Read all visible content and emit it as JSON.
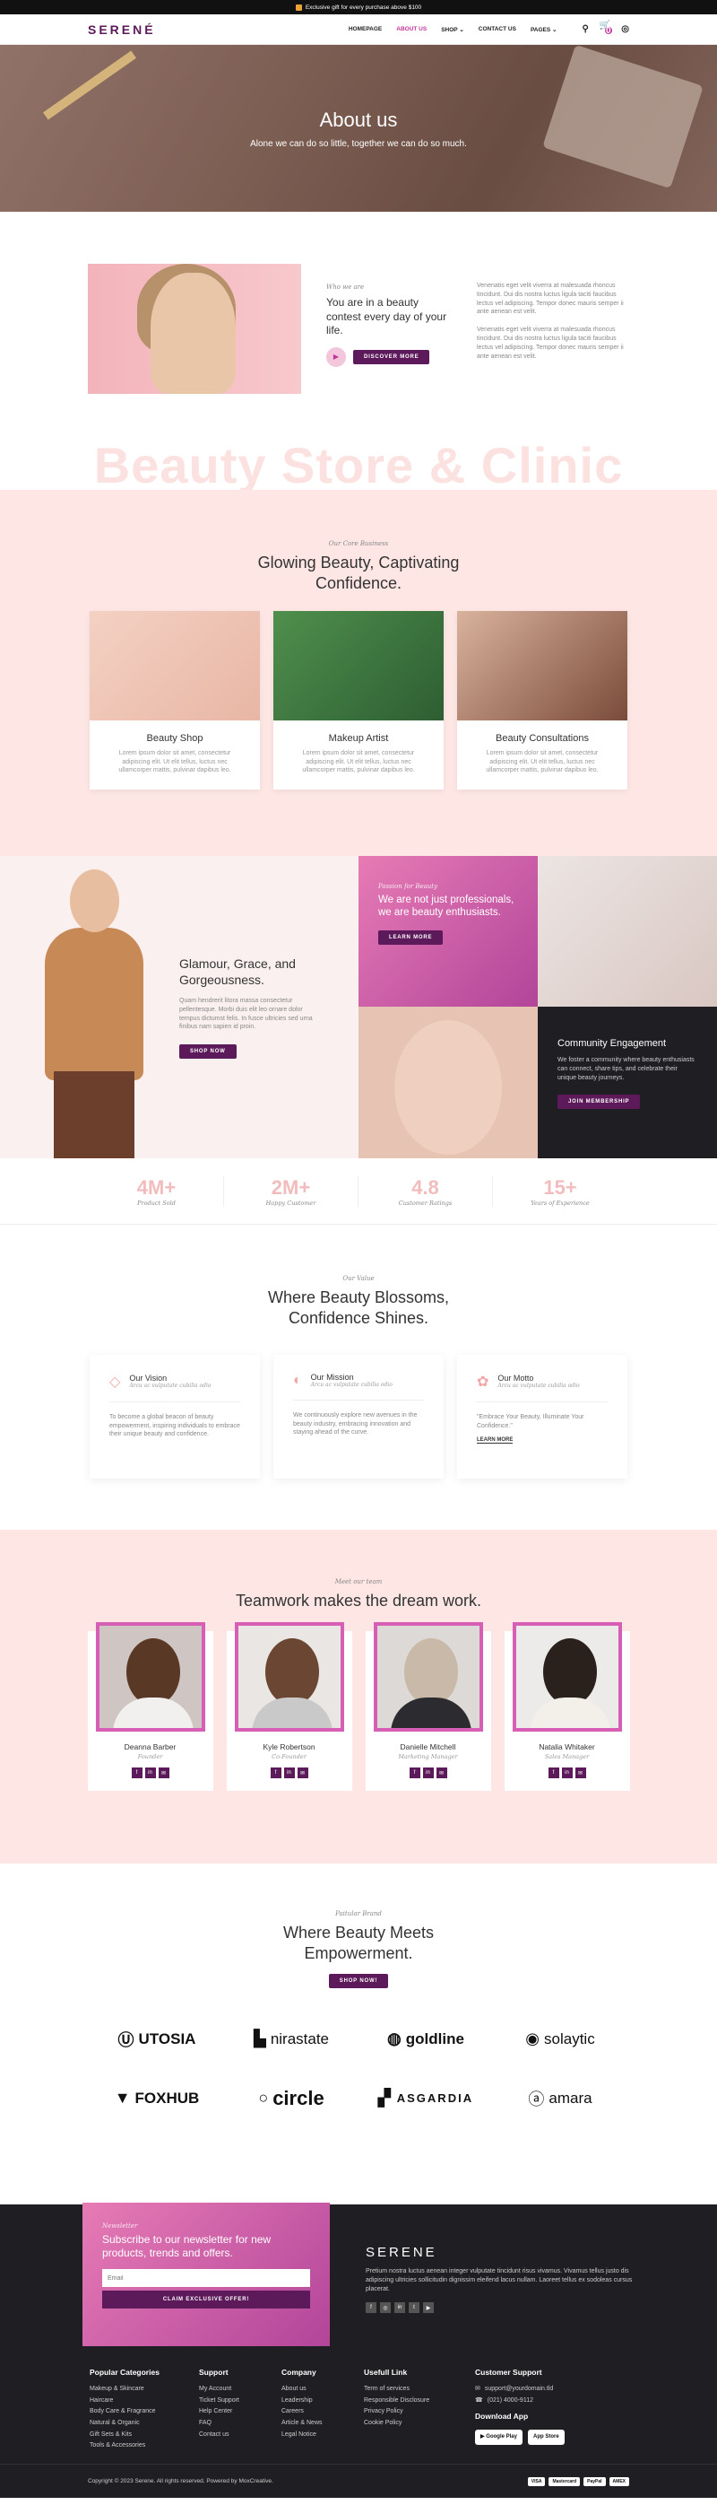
{
  "topbar": {
    "text": "Exclusive gift for every purchase above $100"
  },
  "header": {
    "logo": "SERENÉ",
    "nav": [
      "HOMEPAGE",
      "ABOUT US",
      "SHOP",
      "CONTACT US",
      "PAGES"
    ],
    "cart_count": "0"
  },
  "hero": {
    "title": "About us",
    "subtitle": "Alone we can do so little, together we can do so much."
  },
  "about": {
    "who": "Who we are",
    "heading": "You are in a beauty contest every day of your life.",
    "button": "DISCOVER MORE",
    "para1": "Venenatis eget velit viverra at malesuada rhoncus tincidunt. Dui dis nostra luctus ligula taciti faucibus lectus vel adipiscing. Tempor donec mauris semper ii ante aenean est velit.",
    "para2": "Venenatis eget velit viverra at malesuada rhoncus tincidunt. Dui dis nostra luctus ligula taciti faucibus lectus vel adipiscing. Tempor donec mauris semper ii ante aenean est velit.",
    "bigtitle": "Beauty Store & Clinic"
  },
  "services": {
    "sub": "Our Core Business",
    "title": "Glowing Beauty, Captivating Confidence.",
    "cards": [
      {
        "title": "Beauty Shop",
        "text": "Lorem ipsum dolor sit amet, consectetur adipiscing elit. Ut elit tellus, luctus nec ullamcorper mattis, pulvinar dapibus leo."
      },
      {
        "title": "Makeup Artist",
        "text": "Lorem ipsum dolor sit amet, consectetur adipiscing elit. Ut elit tellus, luctus nec ullamcorper mattis, pulvinar dapibus leo."
      },
      {
        "title": "Beauty Consultations",
        "text": "Lorem ipsum dolor sit amet, consectetur adipiscing elit. Ut elit tellus, luctus nec ullamcorper mattis, pulvinar dapibus leo."
      }
    ]
  },
  "feature": {
    "left_title": "Glamour, Grace, and Gorgeousness.",
    "left_text": "Quam hendrerit litora massa consectetur pellentesque. Morbi duis elit leo ornare dolor tempus dictumst felis. In fusce ultricies sed urna finibus nam sapien id proin.",
    "left_button": "SHOP NOW",
    "pink_sub": "Passion for Beauty",
    "pink_title": "We are not just professionals, we are beauty enthusiasts.",
    "pink_button": "LEARN MORE",
    "dark_title": "Community Engagement",
    "dark_text": "We foster a community where beauty enthusiasts can connect, share tips, and celebrate their unique beauty journeys.",
    "dark_button": "JOIN MEMBERSHIP"
  },
  "stats": [
    {
      "n": "4M+",
      "l": "Product Sold"
    },
    {
      "n": "2M+",
      "l": "Happy Customer"
    },
    {
      "n": "4.8",
      "l": "Customer Ratings"
    },
    {
      "n": "15+",
      "l": "Years of Experience"
    }
  ],
  "values": {
    "sub": "Our Value",
    "title": "Where Beauty Blossoms, Confidence Shines.",
    "cards": [
      {
        "title": "Our Vision",
        "small": "Arcu ac vulputate cubilia odio",
        "text": "To become a global beacon of beauty empowerment, inspiring individuals to embrace their unique beauty and confidence."
      },
      {
        "title": "Our Mission",
        "small": "Arcu ac vulputate cubilia odio",
        "text": "We continuously explore new avenues in the beauty industry, embracing innovation and staying ahead of the curve."
      },
      {
        "title": "Our Motto",
        "small": "Arcu ac vulputate cubilia odio",
        "text": "\"Embrace Your Beauty, Illuminate Your Confidence.\"",
        "link": "LEARN MORE"
      }
    ]
  },
  "team": {
    "sub": "Meet our team",
    "title": "Teamwork makes the dream work.",
    "members": [
      {
        "name": "Deanna Barber",
        "role": "Founder"
      },
      {
        "name": "Kyle Robertson",
        "role": "Co-Founder"
      },
      {
        "name": "Danielle Mitchell",
        "role": "Marketing Manager"
      },
      {
        "name": "Natalia Whitaker",
        "role": "Sales Manager"
      }
    ]
  },
  "partners": {
    "sub": "Paitular Brand",
    "title": "Where Beauty Meets Empowerment.",
    "button": "SHOP NOW!",
    "logos": [
      "UTOSIA",
      "nirastate",
      "goldline",
      "solaytic",
      "FOXHUB",
      "circle",
      "ASGARDIA",
      "amara"
    ]
  },
  "footer": {
    "news_sub": "Newsletter",
    "news_title": "Subscribe to our newsletter for new products, trends and offers.",
    "email_placeholder": "Email",
    "claim": "CLAIM EXCLUSIVE OFFER!",
    "brand": "SERENE",
    "brand_text": "Pretium nostra luctus aenean integer vulputate tincidunt risus vivamus. Vivamus tellus justo dis adipiscing ultricies sollicitudin dignissim eleifend lacus nullam. Laoreet tellus ex sodoleas cursus placerat.",
    "cols": [
      {
        "title": "Popular Categories",
        "items": [
          "Makeup & Skincare",
          "Haircare",
          "Body Care & Fragrance",
          "Natural & Organic",
          "Gift Sets & Kits",
          "Tools & Accessories"
        ]
      },
      {
        "title": "Support",
        "items": [
          "My Account",
          "Ticket Support",
          "Help Center",
          "FAQ",
          "Contact us"
        ]
      },
      {
        "title": "Company",
        "items": [
          "About us",
          "Leadership",
          "Careers",
          "Article & News",
          "Legal Notice"
        ]
      },
      {
        "title": "Usefull Link",
        "items": [
          "Term of services",
          "Responsible Disclosure",
          "Privacy Policy",
          "Cookie Policy"
        ]
      }
    ],
    "support_title": "Customer Support",
    "email": "support@yourdomain.tld",
    "phone": "(021) 4000-9112",
    "download": "Download App",
    "google": "Google Play",
    "apple": "App Store",
    "copyright": "Copyright © 2023 Serene. All rights reserved. Powered by MoxCreative.",
    "pays": [
      "VISA",
      "Mastercard",
      "PayPal",
      "AMEX"
    ]
  }
}
